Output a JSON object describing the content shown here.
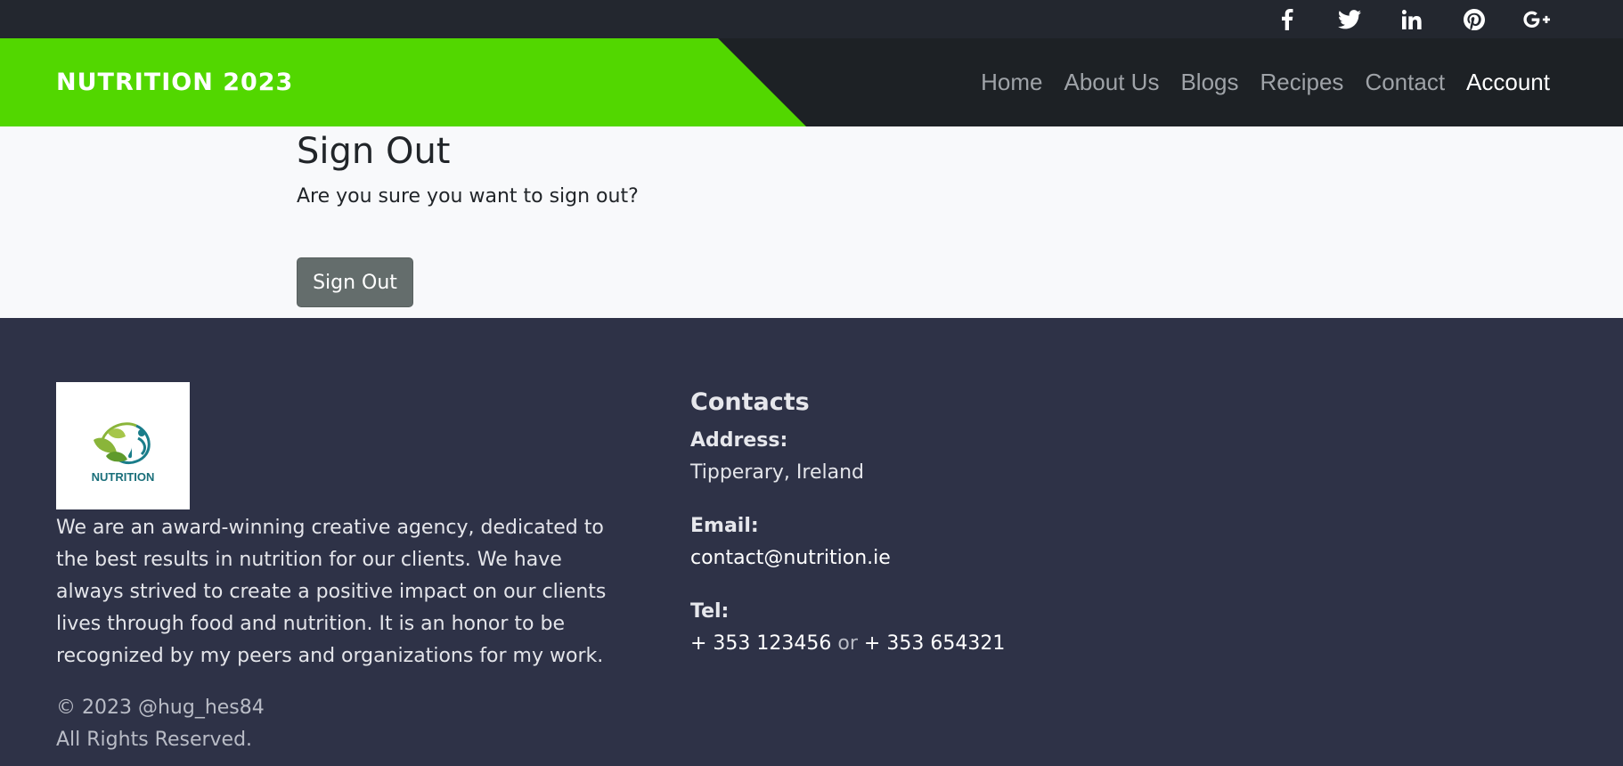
{
  "social": {
    "items": [
      {
        "icon": "facebook-icon"
      },
      {
        "icon": "twitter-icon"
      },
      {
        "icon": "linkedin-icon"
      },
      {
        "icon": "pinterest-icon"
      },
      {
        "icon": "google-plus-icon"
      }
    ]
  },
  "nav": {
    "brand": "NUTRITION 2023",
    "links": [
      "Home",
      "About Us",
      "Blogs",
      "Recipes",
      "Contact",
      "Account"
    ],
    "active": "Account",
    "accent_color": "#52d700"
  },
  "main": {
    "title": "Sign Out",
    "confirm_text": "Are you sure you want to sign out?",
    "button_label": "Sign Out"
  },
  "footer": {
    "logo_text": "NUTRITION",
    "about": "We are an award-winning creative agency, dedicated to the best results in nutrition for our clients. We have always strived to create a positive impact on our clients lives through food and nutrition. It is an honor to be recognized by my peers and organizations for my work.",
    "copyright_line1": "© 2023 @hug_hes84",
    "copyright_line2": "All Rights Reserved.",
    "contacts": {
      "heading": "Contacts",
      "address_label": "Address:",
      "address_value": "Tipperary, Ireland",
      "email_label": "Email:",
      "email_value": "contact@nutrition.ie",
      "tel_label": "Tel:",
      "tel_1": "+ 353 123456",
      "tel_or": "or",
      "tel_2": "+ 353 654321"
    }
  }
}
